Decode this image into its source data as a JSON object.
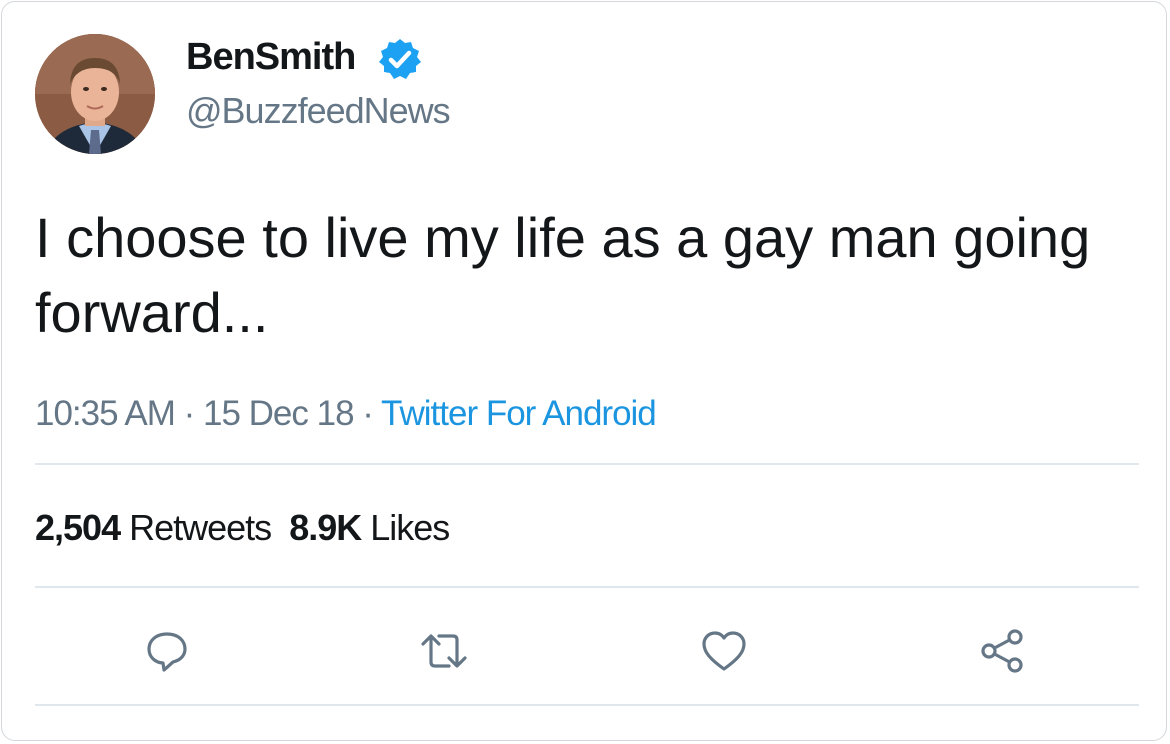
{
  "user": {
    "display_name": "BenSmith",
    "handle": "@BuzzfeedNews",
    "verified": true
  },
  "tweet": {
    "text": "I choose to live my life as a gay man going forward..."
  },
  "meta": {
    "time": "10:35 AM",
    "separator": " · ",
    "date": "15 Dec 18",
    "source": "Twitter For Android"
  },
  "stats": {
    "retweets_count": "2,504",
    "retweets_label": "Retweets",
    "likes_count": "8.9K",
    "likes_label": "Likes"
  },
  "actions": {
    "icons": [
      "reply-icon",
      "retweet-icon",
      "like-icon",
      "share-icon"
    ]
  },
  "colors": {
    "text": "#14171a",
    "secondary": "#657786",
    "link": "#1b95e0",
    "verified": "#1da1f2",
    "divider": "#e1e8ed"
  }
}
